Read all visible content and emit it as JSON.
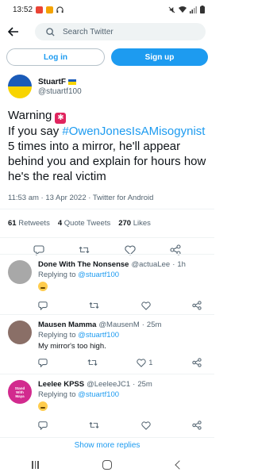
{
  "status_bar": {
    "time": "13:52",
    "battery": "▮"
  },
  "search": {
    "placeholder": "Search Twitter"
  },
  "auth": {
    "login_label": "Log in",
    "signup_label": "Sign up"
  },
  "tweet": {
    "author_name": "StuartF",
    "author_handle": "@stuartf100",
    "text_part1": "Warning",
    "text_part2": "If you say",
    "hashtag": "#OwenJonesIsAMisogynist",
    "text_part3": "5 times into a mirror, he'll appear behind you and explain for hours how he's the real victim",
    "time": "11:53 am",
    "date": "13 Apr 2022",
    "source": "Twitter for Android",
    "retweets_count": "61",
    "retweets_label": "Retweets",
    "quotes_count": "4",
    "quotes_label": "Quote Tweets",
    "likes_count": "270",
    "likes_label": "Likes"
  },
  "replies": [
    {
      "name": "Done With The Nonsense",
      "handle": "@actuaLee",
      "time": "1h",
      "replying_prefix": "Replying to",
      "replying_to": "@stuartf100",
      "text": "",
      "like_count": "",
      "avatar_color": "#a8a8a8"
    },
    {
      "name": "Mausen Mamma",
      "handle": "@MausenM",
      "time": "25m",
      "replying_prefix": "Replying to",
      "replying_to": "@stuartf100",
      "text": "My mirror's too high.",
      "like_count": "1",
      "avatar_color": "#8a6f67"
    },
    {
      "name": "Leelee KPSS",
      "handle": "@LeeleeJC1",
      "time": "25m",
      "replying_prefix": "Replying to",
      "replying_to": "@stuartf100",
      "text": "",
      "like_count": "",
      "avatar_color": "#d22a8e",
      "avatar_text": "Stand With Maya"
    }
  ],
  "show_more": "Show more replies",
  "colors": {
    "accent": "#1d9bf0",
    "text": "#0f1419",
    "muted": "#536471"
  }
}
